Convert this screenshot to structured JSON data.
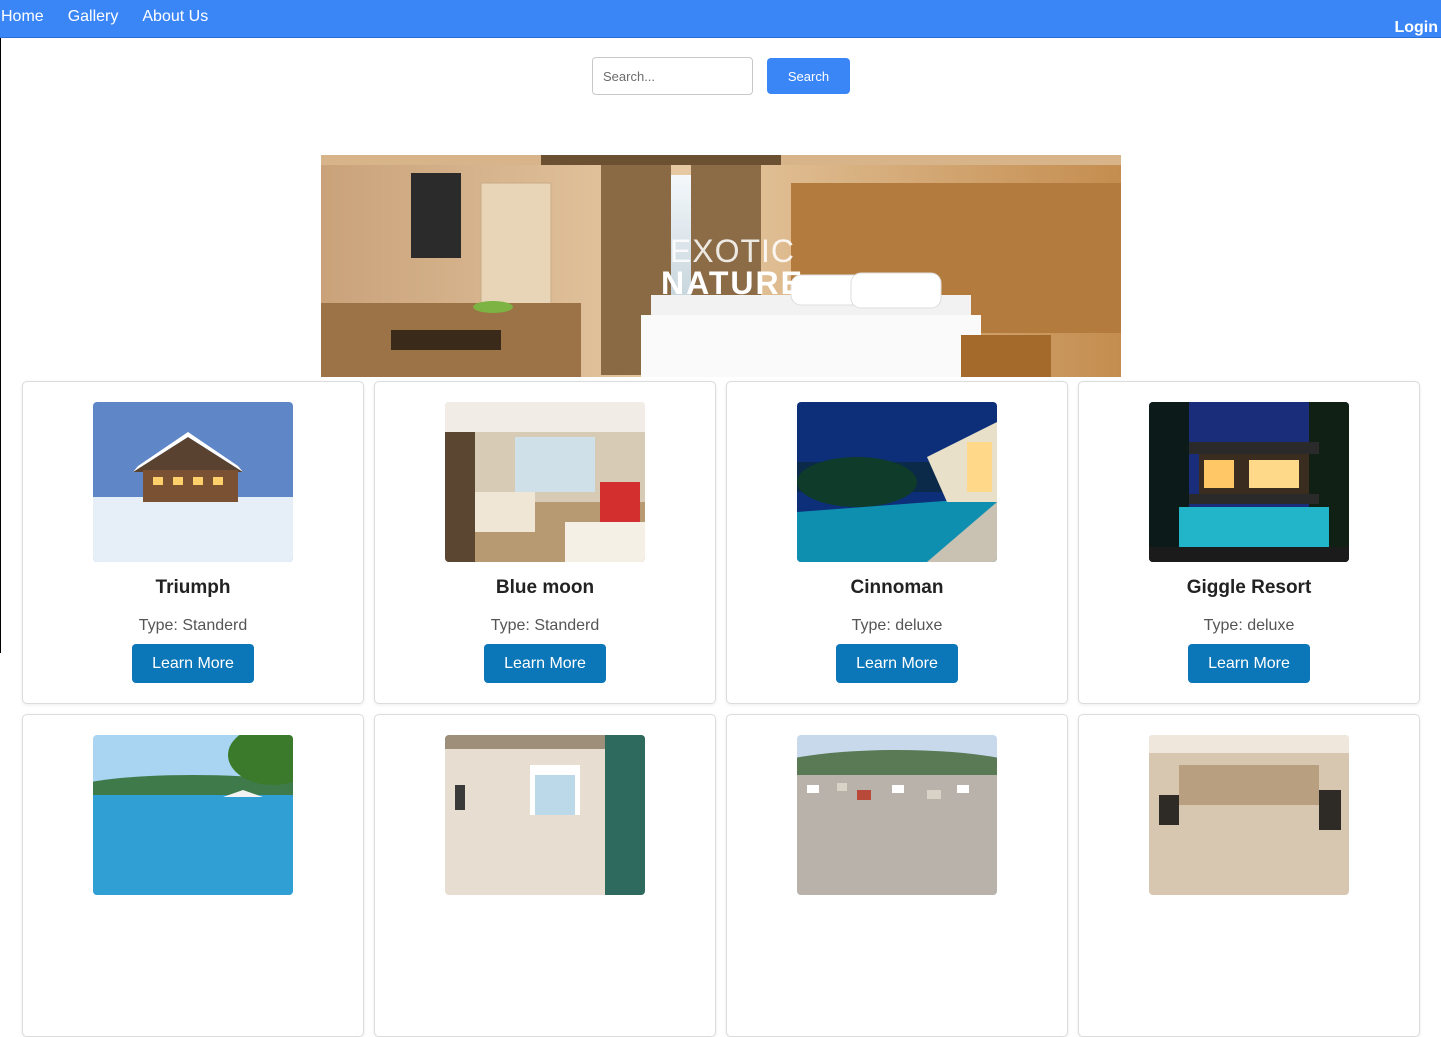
{
  "nav": {
    "links": [
      "Home",
      "Gallery",
      "About Us"
    ],
    "login_label": "Login",
    "color": "#3b86f7"
  },
  "search": {
    "placeholder": "Search...",
    "button_label": "Search"
  },
  "hero": {
    "line1": "EXOTIC",
    "line2": "NATURE"
  },
  "cards": [
    {
      "title": "Triumph",
      "type": "Type: Standerd",
      "button": "Learn More",
      "image": "snowy-chalet"
    },
    {
      "title": "Blue moon",
      "type": "Type: Standerd",
      "button": "Learn More",
      "image": "hotel-room"
    },
    {
      "title": "Cinnoman",
      "type": "Type: deluxe",
      "button": "Learn More",
      "image": "infinity-pool"
    },
    {
      "title": "Giggle Resort",
      "type": "Type: deluxe",
      "button": "Learn More",
      "image": "modern-villa"
    },
    {
      "image": "beach"
    },
    {
      "image": "bedroom"
    },
    {
      "image": "hillside-town"
    },
    {
      "image": "lobby"
    }
  ]
}
